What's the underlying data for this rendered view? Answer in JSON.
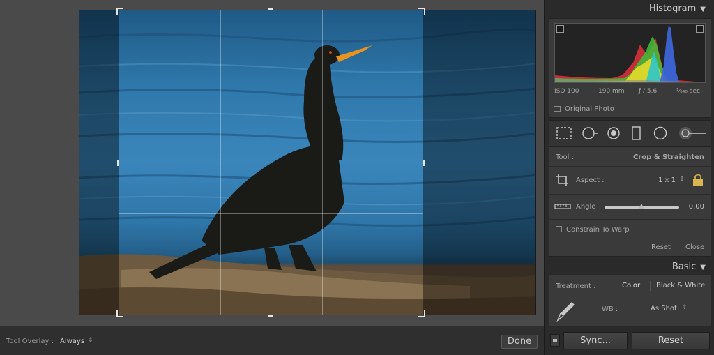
{
  "toolbar": {
    "overlay_label": "Tool Overlay :",
    "overlay_value": "Always",
    "overlay_arrows": "⇕",
    "done_label": "Done"
  },
  "histogram": {
    "title": "Histogram",
    "iso": "ISO 100",
    "focal": "190 mm",
    "aperture": "ƒ / 5.6",
    "shutter": "¹⁄₆₄₀ sec",
    "original_photo": "Original Photo"
  },
  "crop": {
    "tool_label": "Tool :",
    "tool_value": "Crop & Straighten",
    "aspect_label": "Aspect :",
    "aspect_value": "1 x 1",
    "aspect_arrows": "⇕",
    "angle_label": "Angle",
    "angle_value": "0.00",
    "constrain_label": "Constrain To Warp",
    "reset_label": "Reset",
    "close_label": "Close"
  },
  "basic": {
    "title": "Basic",
    "treatment_label": "Treatment :",
    "color_label": "Color",
    "bw_label": "Black & White",
    "wb_label": "WB :",
    "wb_value": "As Shot",
    "wb_arrows": "⇕"
  },
  "footer": {
    "sync_label": "Sync...",
    "reset_label": "Reset"
  },
  "colors": {
    "panel_bg": "#2a2a2a",
    "box_bg": "#3a3a3a",
    "water": "#3a86bb"
  }
}
